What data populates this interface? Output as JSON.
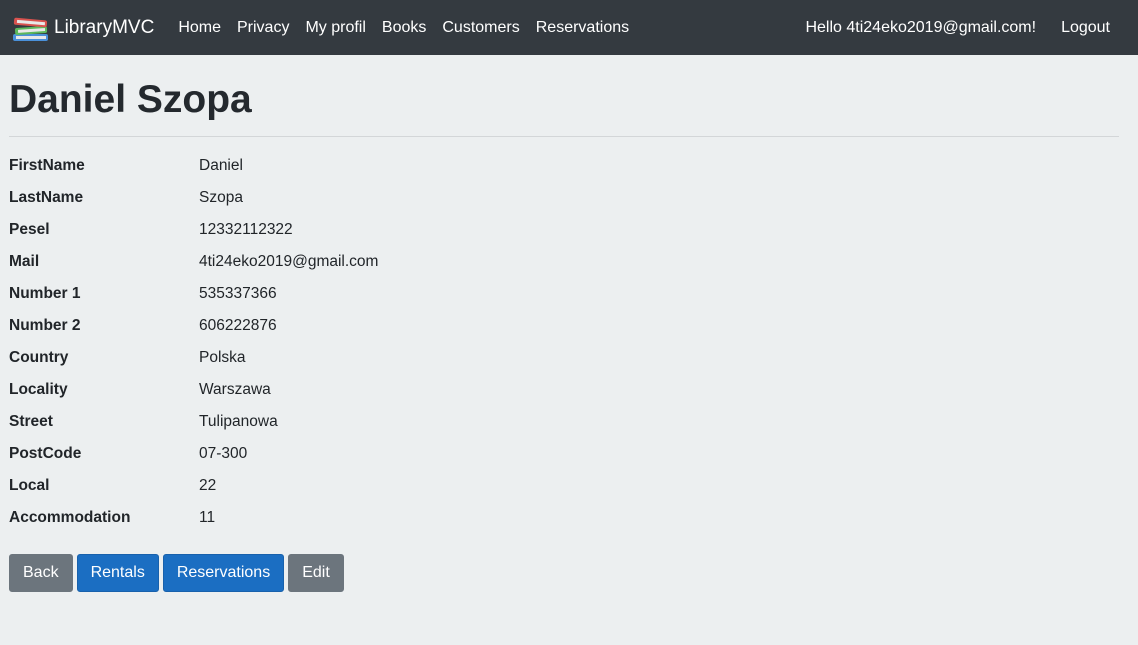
{
  "nav": {
    "brand": "LibraryMVC",
    "links": [
      "Home",
      "Privacy",
      "My profil",
      "Books",
      "Customers",
      "Reservations"
    ],
    "greeting": "Hello 4ti24eko2019@gmail.com!",
    "logout": "Logout",
    "brand_icon": "books-stack-icon"
  },
  "page": {
    "title": "Daniel Szopa"
  },
  "details": [
    {
      "label": "FirstName",
      "value": "Daniel"
    },
    {
      "label": "LastName",
      "value": "Szopa"
    },
    {
      "label": "Pesel",
      "value": "12332112322"
    },
    {
      "label": "Mail",
      "value": "4ti24eko2019@gmail.com"
    },
    {
      "label": "Number 1",
      "value": "535337366"
    },
    {
      "label": "Number 2",
      "value": "606222876"
    },
    {
      "label": "Country",
      "value": "Polska"
    },
    {
      "label": "Locality",
      "value": "Warszawa"
    },
    {
      "label": "Street",
      "value": "Tulipanowa"
    },
    {
      "label": "PostCode",
      "value": "07-300"
    },
    {
      "label": "Local",
      "value": "22"
    },
    {
      "label": "Accommodation",
      "value": "11"
    }
  ],
  "buttons": {
    "back": "Back",
    "rentals": "Rentals",
    "reservations": "Reservations",
    "edit": "Edit"
  },
  "colors": {
    "navbar": "#343a40",
    "primary": "#1b6ec2",
    "secondary": "#6c757d",
    "background": "#eceff0"
  }
}
